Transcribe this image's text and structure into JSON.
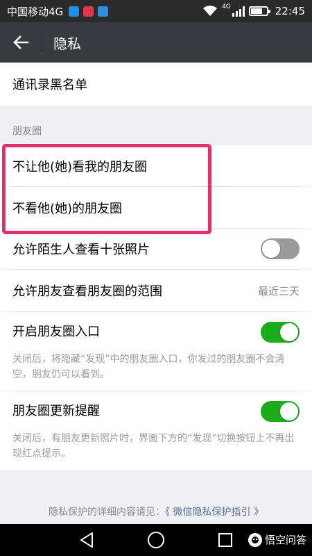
{
  "status_bar": {
    "carrier": "中国移动4G",
    "network_badge": "4G",
    "time": "22:45",
    "battery_level": 0.75,
    "app_icons": [
      {
        "name": "app-icon-blue",
        "color": "#1e90e6"
      },
      {
        "name": "app-icon-red",
        "color": "#e0394b"
      },
      {
        "name": "app-icon-gallery",
        "color": "#2f8ee0"
      }
    ]
  },
  "header": {
    "back_icon": "arrow-left-icon",
    "title": "隐私"
  },
  "blacklist": {
    "label": "通讯录黑名单"
  },
  "moments": {
    "section_label": "朋友圈",
    "items": [
      {
        "label": "不让他(她)看我的朋友圈"
      },
      {
        "label": "不看他(她)的朋友圈"
      }
    ],
    "stranger_photos": {
      "label": "允许陌生人查看十张照片",
      "enabled": false
    },
    "friend_range": {
      "label": "允许朋友查看朋友圈的范围",
      "value": "最近三天"
    },
    "entrance": {
      "label": "开启朋友圈入口",
      "enabled": true,
      "description": "关闭后，将隐藏“发现”中的朋友圈入口，你发过的朋友圈不会清空，朋友仍可以看到。"
    },
    "update_reminder": {
      "label": "朋友圈更新提醒",
      "enabled": true,
      "description": "关闭后，有朋友更新照片时，界面下方的“发现”切换按钮上不再出现红点提示。"
    }
  },
  "footer": {
    "text": "隐私保护的详细内容请见：",
    "link": "《 微信隐私保护指引 》"
  },
  "watermark": {
    "text": "悟空问答"
  },
  "colors": {
    "toggle_on": "#1aad19",
    "toggle_off": "#9b9b9b",
    "highlight": "#e5306e",
    "title_bar": "#393a3f",
    "link": "#576b95"
  }
}
